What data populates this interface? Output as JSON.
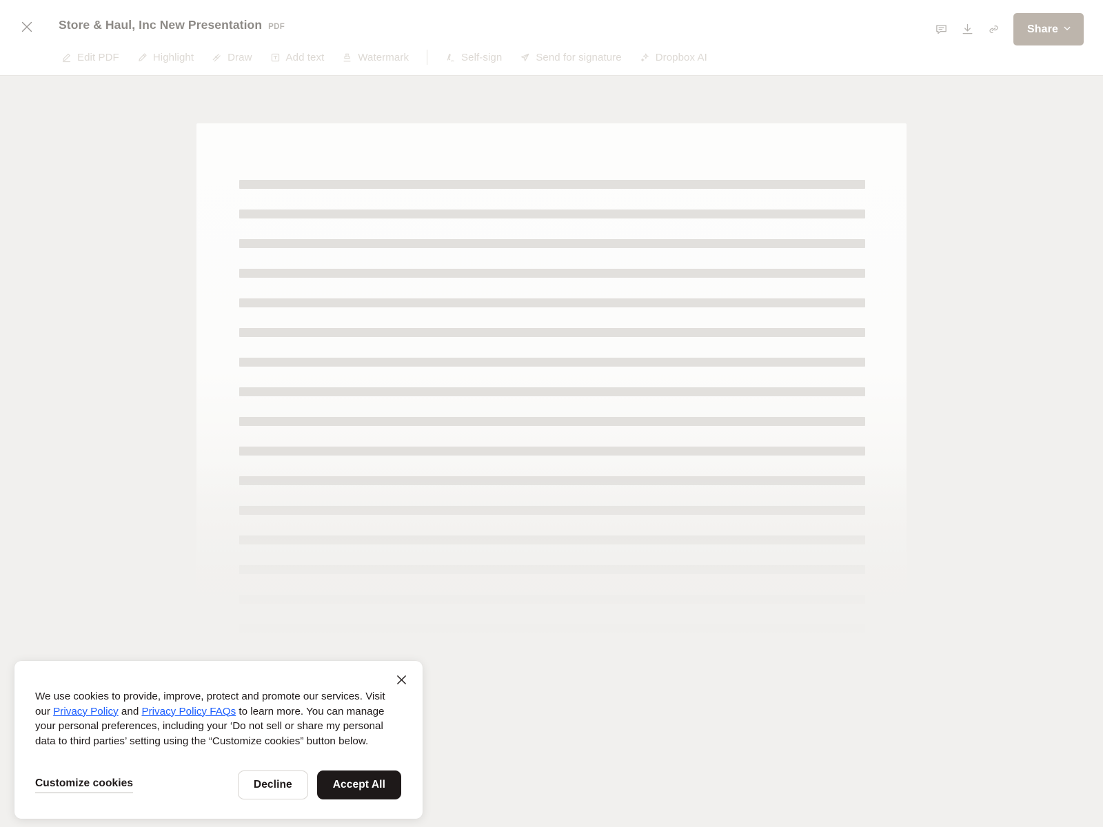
{
  "header": {
    "close_icon": "close-icon",
    "document_title": "Store & Haul, Inc New Presentation",
    "file_extension": "PDF",
    "actions": [
      {
        "name": "comment-icon",
        "label": "Comments"
      },
      {
        "name": "download-icon",
        "label": "Download"
      },
      {
        "name": "link-icon",
        "label": "Copy link"
      }
    ],
    "share_label": "Share",
    "share_chevron": "chevron-down-icon",
    "share_button_color": "#bdb5ac"
  },
  "toolbar": {
    "items": [
      {
        "icon": "pencil-icon",
        "label": "Edit PDF"
      },
      {
        "icon": "highlighter-icon",
        "label": "Highlight"
      },
      {
        "icon": "scribble-icon",
        "label": "Draw"
      },
      {
        "icon": "text-box-icon",
        "label": "Add text"
      },
      {
        "icon": "stamp-icon",
        "label": "Watermark"
      },
      {
        "icon": "signature-icon",
        "label": "Self-sign"
      },
      {
        "icon": "paper-plane-icon",
        "label": "Send for signature"
      },
      {
        "icon": "sparkle-icon",
        "label": "Dropbox AI"
      }
    ],
    "separator_after_index": 4,
    "label_color": "#ddd9d4"
  },
  "document": {
    "state": "loading",
    "skeleton_line_count": 16,
    "page_background": "#fcfcfb",
    "skeleton_color": "#e2e0dd",
    "canvas_background": "#f1f0ee"
  },
  "cookie_banner": {
    "close_icon": "close-icon",
    "body_part_1": "We use cookies to provide, improve, protect and promote our services. Visit our ",
    "link_1": "Privacy Policy",
    "body_part_2": " and ",
    "link_2": "Privacy Policy FAQs",
    "body_part_3": " to learn more. You can manage your personal preferences, including your ‘Do not sell or share my personal data to third parties’ setting using the “Customize cookies” button below.",
    "customize_label": "Customize cookies",
    "decline_label": "Decline",
    "accept_label": "Accept All",
    "link_color": "#1b5eff",
    "accept_button_color": "#1e1919"
  }
}
